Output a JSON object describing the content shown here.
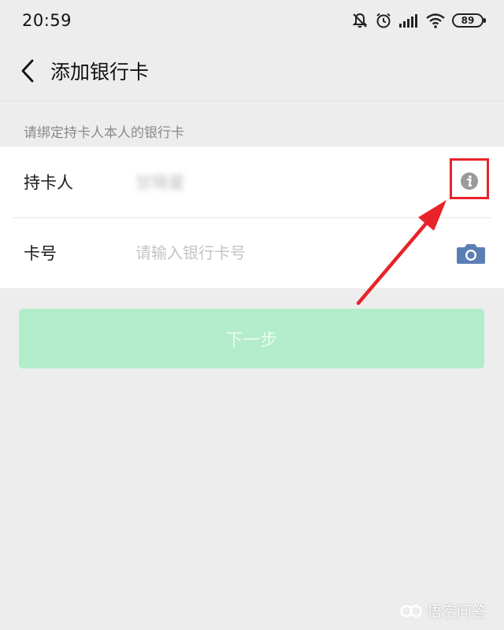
{
  "status_bar": {
    "time": "20:59",
    "battery": "89",
    "icons": [
      "mute-bell-icon",
      "alarm-icon",
      "signal-icon",
      "wifi-icon",
      "battery-icon"
    ]
  },
  "nav": {
    "back_icon": "chevron-left-icon",
    "title": "添加银行卡"
  },
  "form": {
    "hint": "请绑定持卡人本人的银行卡",
    "cardholder": {
      "label": "持卡人",
      "value": "甘晓星",
      "action_icon": "info-icon"
    },
    "card_number": {
      "label": "卡号",
      "placeholder": "请输入银行卡号",
      "action_icon": "camera-icon"
    }
  },
  "next_button": {
    "label": "下一步",
    "enabled": false
  },
  "colors": {
    "background": "#ededed",
    "button_disabled": "#b3ecca",
    "annotation": "#e8232a",
    "camera_icon": "#5b7fb5"
  },
  "watermark": {
    "text": "悟空问答"
  }
}
